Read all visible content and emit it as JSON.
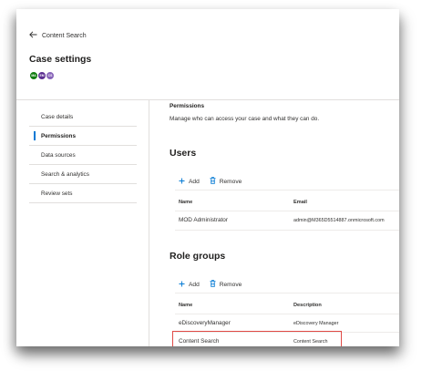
{
  "header": {
    "back_label": "Content Search",
    "title": "Case settings",
    "avatars": [
      {
        "initials": "MA",
        "color": "#107c10"
      },
      {
        "initials": "EM",
        "color": "#5c2e91"
      },
      {
        "initials": "CS",
        "color": "#8764b8"
      }
    ]
  },
  "nav": {
    "items": [
      {
        "label": "Case details",
        "active": false
      },
      {
        "label": "Permissions",
        "active": true
      },
      {
        "label": "Data sources",
        "active": false
      },
      {
        "label": "Search & analytics",
        "active": false
      },
      {
        "label": "Review sets",
        "active": false
      }
    ]
  },
  "permissions": {
    "title": "Permissions",
    "subtitle": "Manage who can access your case and what they can do."
  },
  "users": {
    "title": "Users",
    "add_label": "Add",
    "remove_label": "Remove",
    "columns": [
      "Name",
      "Email"
    ],
    "rows": [
      {
        "name": "MOD Administrator",
        "email": "admin@M365D5514887.onmicrosoft.com"
      }
    ]
  },
  "role_groups": {
    "title": "Role groups",
    "add_label": "Add",
    "remove_label": "Remove",
    "columns": [
      "Name",
      "Description"
    ],
    "rows": [
      {
        "name": "eDiscoveryManager",
        "description": "eDiscovery Manager"
      },
      {
        "name": "Content Search",
        "description": "Content Search"
      }
    ]
  },
  "colors": {
    "accent": "#0078d4",
    "highlight_border": "#e04a46"
  }
}
